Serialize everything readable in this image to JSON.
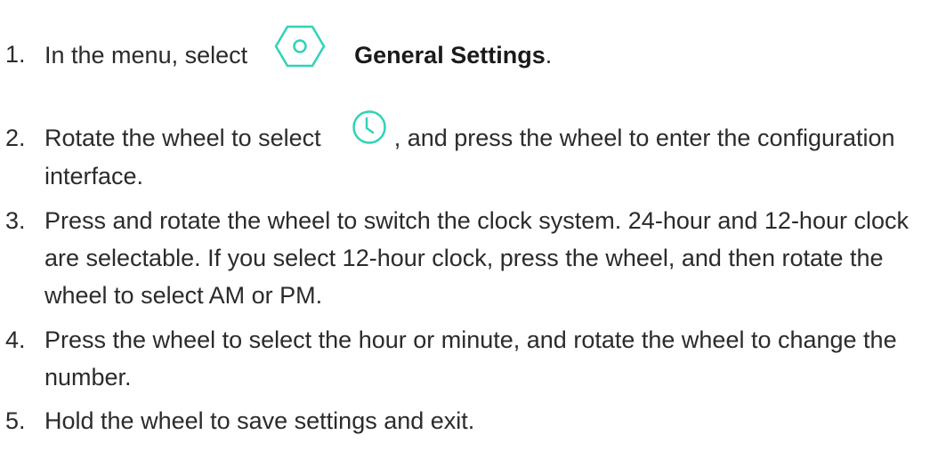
{
  "steps": [
    {
      "number": "1.",
      "text_before": "In the menu, select",
      "icon": "general-settings-hexagon-icon",
      "bold": "General Settings",
      "text_after": "."
    },
    {
      "number": "2.",
      "text_before": "Rotate the wheel to select",
      "icon": "clock-icon",
      "text_after": ", and press the wheel to enter the configuration interface."
    },
    {
      "number": "3.",
      "text": "Press and rotate the wheel to switch the clock system. 24-hour and 12-hour clock are selectable. If you select 12-hour clock, press the wheel, and then rotate the wheel to select AM or PM."
    },
    {
      "number": "4.",
      "text": "Press the wheel to select the hour or minute, and rotate the wheel to change the number."
    },
    {
      "number": "5.",
      "text": "Hold the wheel to save settings and exit."
    }
  ],
  "colors": {
    "icon_accent": "#2fd3b6",
    "text": "#2b2b2b"
  }
}
